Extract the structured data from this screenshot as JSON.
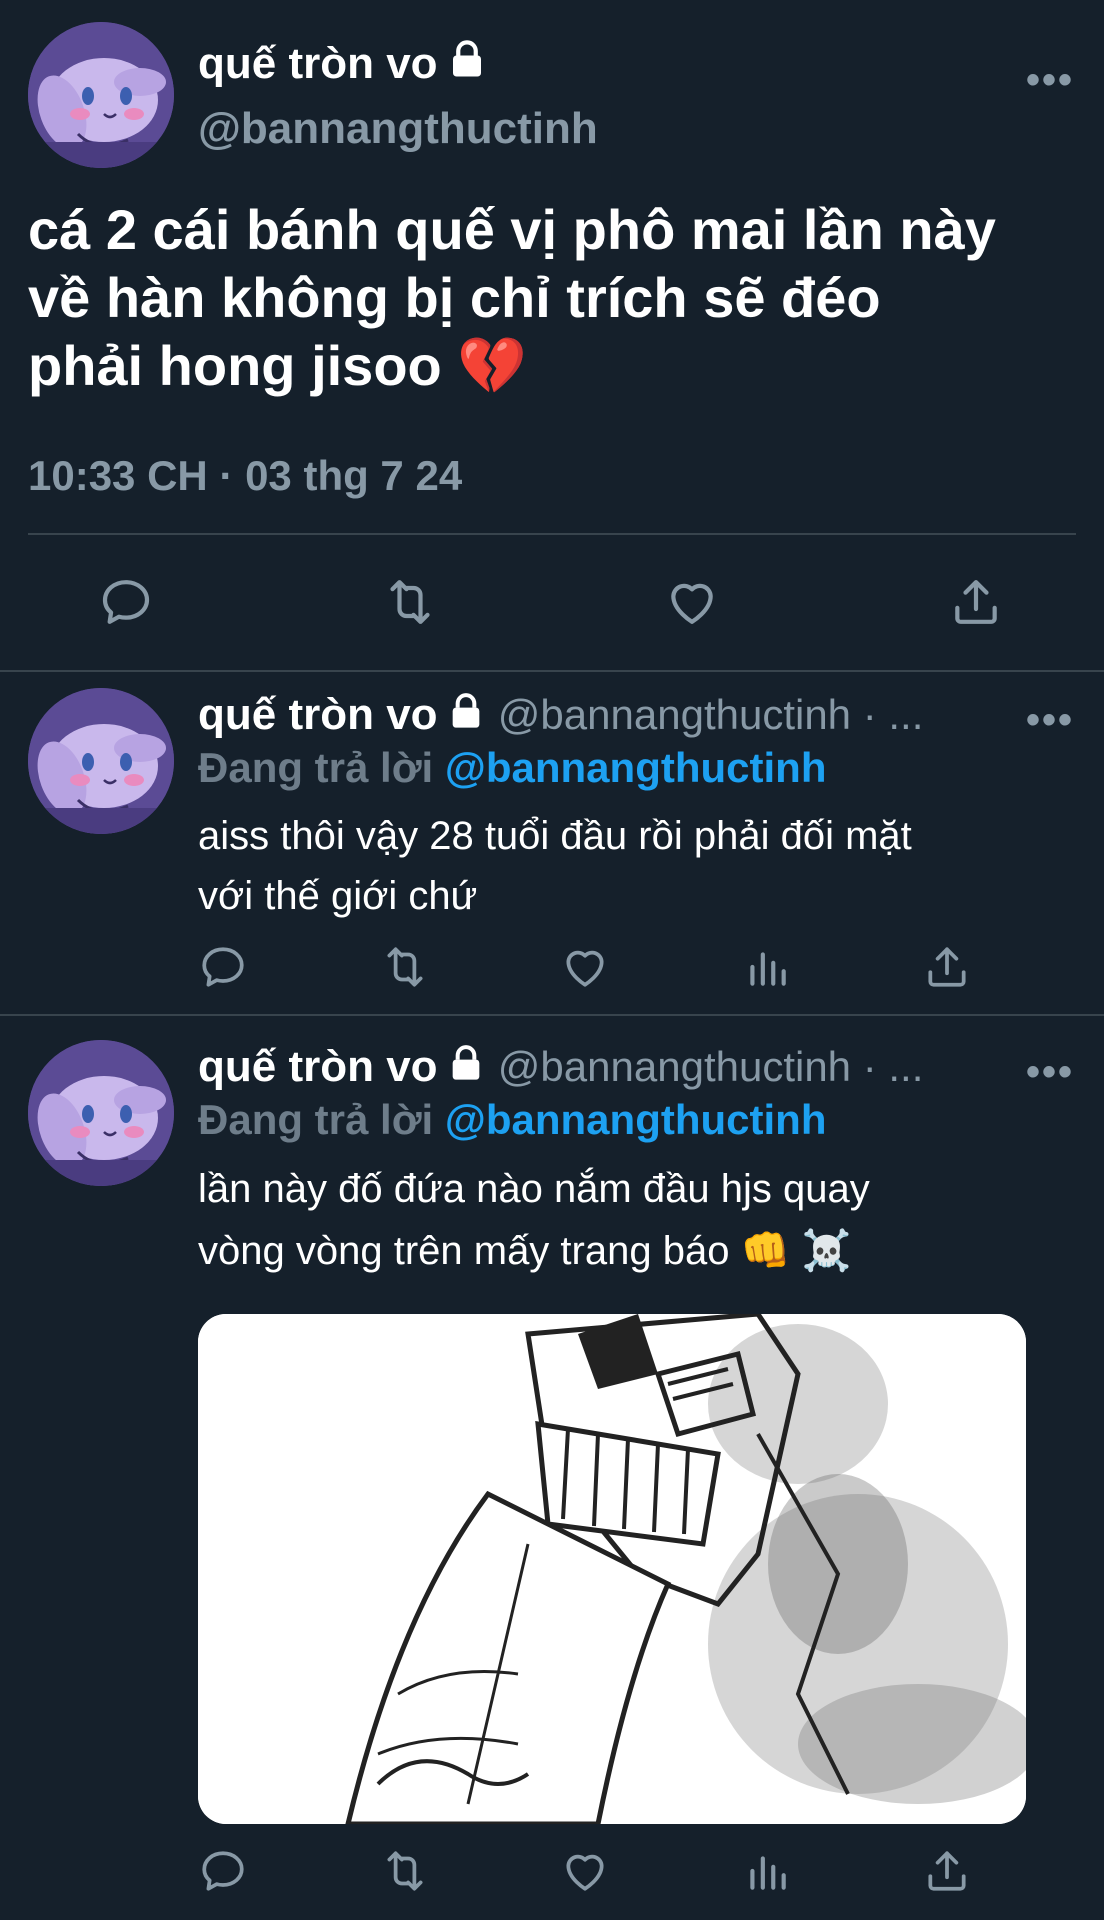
{
  "main_tweet": {
    "display_name": "quế tròn vo",
    "handle": "@bannangthuctinh",
    "text_line1": "cá 2 cái bánh quế vị phô mai lần này",
    "text_line2": "về hàn không bị chỉ trích sẽ đéo",
    "text_line3": "phải hong jisoo 💔",
    "timestamp": "10:33 CH · 03 thg 7 24",
    "more_label": "•••"
  },
  "replies": [
    {
      "display_name": "quế tròn vo",
      "handle": "@bannangthuctinh · ...",
      "replying_label": "Đang trả lời",
      "replying_to": "@bannangthuctinh",
      "text_line1": "aiss thôi vậy 28 tuổi đầu rồi phải đối mặt",
      "text_line2": "với thế giới chứ",
      "more_label": "•••"
    },
    {
      "display_name": "quế tròn vo",
      "handle": "@bannangthuctinh · ...",
      "replying_label": "Đang trả lời",
      "replying_to": "@bannangthuctinh",
      "text_line1": "lần này đố đứa nào nắm đầu hjs quay",
      "text_line2": "vòng vòng trên mấy trang báo 👊 ☠️",
      "more_label": "•••"
    }
  ],
  "colors": {
    "background": "#15202b",
    "text_primary": "#ffffff",
    "text_secondary": "#8899a6",
    "mention": "#1da1f2",
    "divider": "#38444d"
  },
  "icons": {
    "reply": "reply-icon",
    "retweet": "retweet-icon",
    "like": "heart-icon",
    "share": "share-icon",
    "views": "views-icon",
    "lock": "lock-icon",
    "more": "more-icon"
  }
}
